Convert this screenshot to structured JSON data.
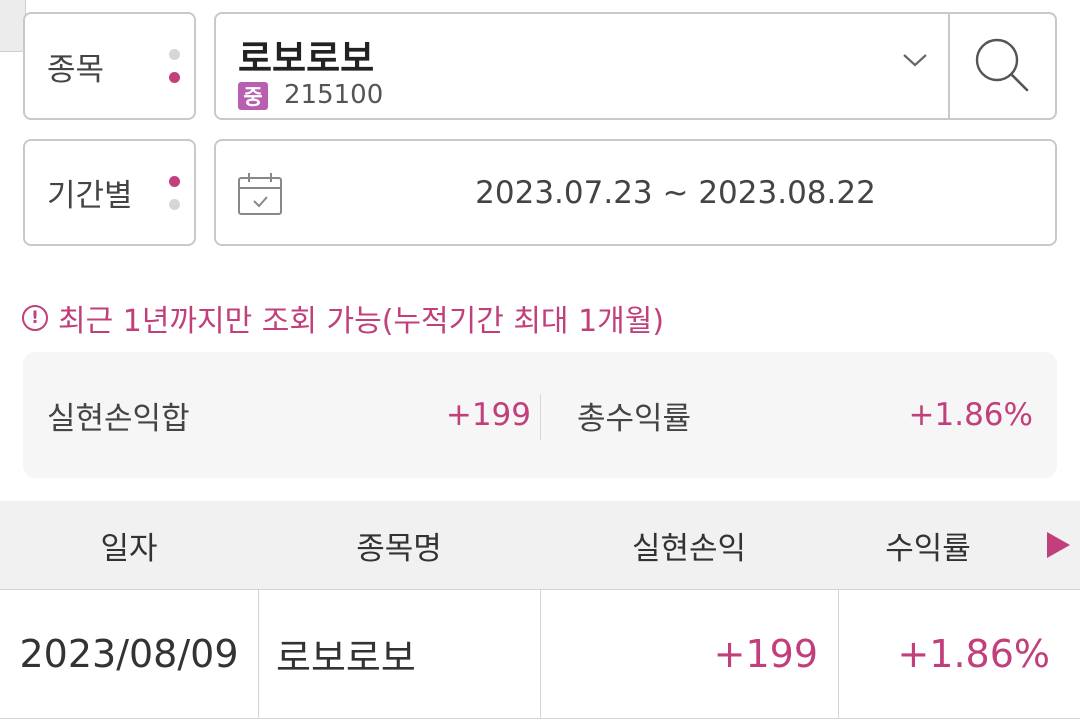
{
  "colors": {
    "accent": "#c13f7b",
    "border": "#c9c9c9",
    "badge": "#b85fb0"
  },
  "stock_selector": {
    "label": "종목",
    "name": "로보로보",
    "market_badge": "중",
    "code": "215100"
  },
  "period_selector": {
    "label": "기간별",
    "date_range": "2023.07.23 ~ 2023.08.22"
  },
  "notice": {
    "icon": "alert-circle-icon",
    "text": "최근 1년까지만 조회 가능(누적기간 최대 1개월)"
  },
  "summary": {
    "realized_pl_label": "실현손익합",
    "realized_pl_value": "+199",
    "return_label": "총수익률",
    "return_value": "+1.86%"
  },
  "table": {
    "headers": [
      "일자",
      "종목명",
      "실현손익",
      "수익률"
    ],
    "rows": [
      {
        "date": "2023/08/09",
        "name": "로보로보",
        "pl": "+199",
        "rate": "+1.86%"
      }
    ]
  }
}
